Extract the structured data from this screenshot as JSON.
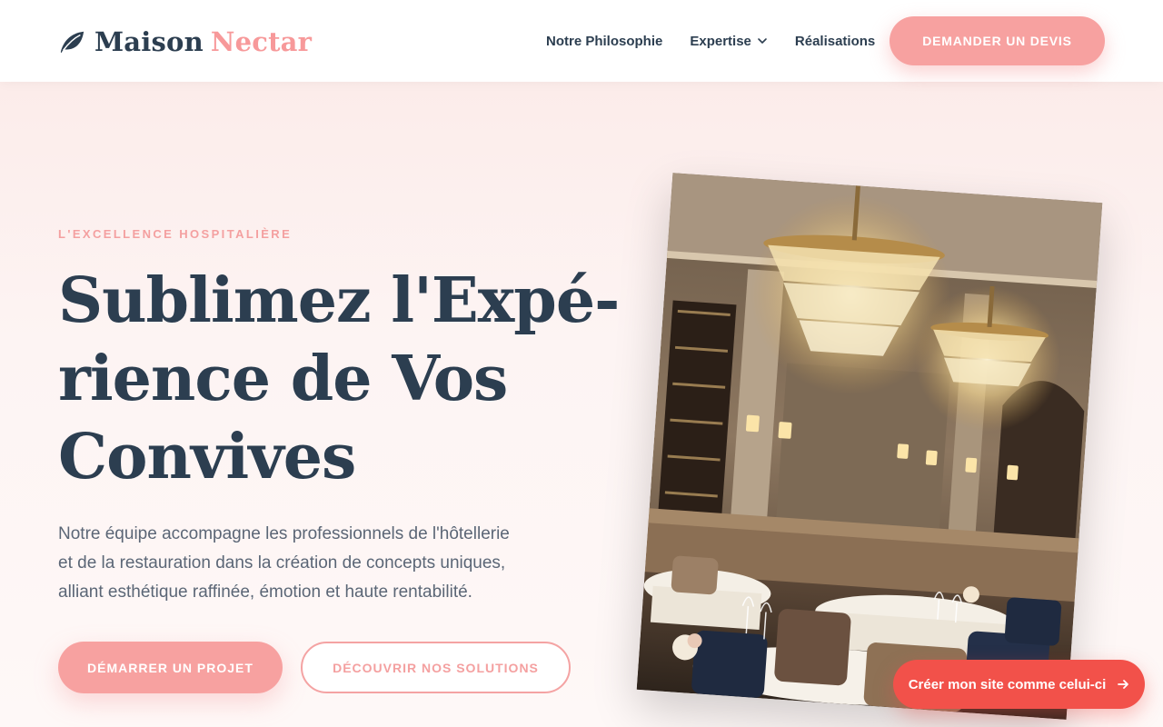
{
  "brand": {
    "name_main": "Maison",
    "name_accent": "Nectar",
    "logo_icon": "leaf-icon"
  },
  "nav": {
    "items": [
      {
        "label": "Notre Philosophie"
      },
      {
        "label": "Expertise",
        "icon": "chevron-down-icon"
      },
      {
        "label": "Réalisations"
      }
    ],
    "cta_label": "DEMANDER UN DEVIS"
  },
  "hero": {
    "eyebrow": "L'EXCELLENCE HOSPITALIÈRE",
    "headline_lines": [
      "Sublimez l'Expé-",
      "rience de Vos",
      "Convives"
    ],
    "lead_lines": [
      "Notre équipe accompagne les professionnels de l'hôtellerie",
      "et de la restauration dans la création de concepts uniques,",
      "alliant esthétique raffinée, émotion et haute rentabilité."
    ],
    "primary_button": "DÉMARRER UN PROJET",
    "secondary_button": "DÉCOUVRIR NOS SOLUTIONS"
  },
  "floating_cta": {
    "label": "Créer mon site comme celui-ci",
    "icon": "arrow-right-icon"
  },
  "colors": {
    "navy": "#2c3e50",
    "rose": "#f7a1a0",
    "coral": "#f2514a",
    "background": "#fdf4f3"
  }
}
